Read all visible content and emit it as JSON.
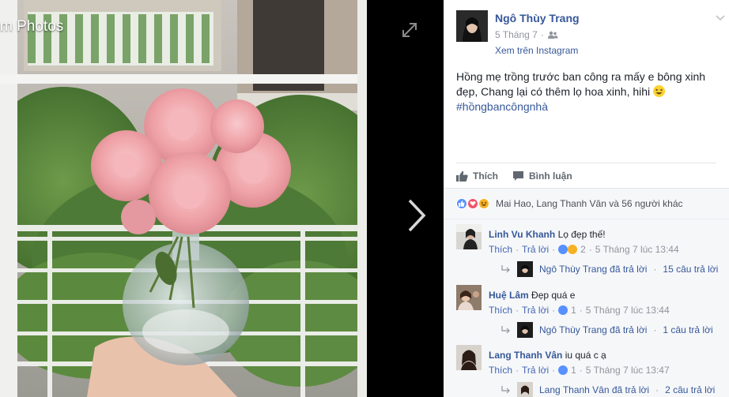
{
  "album": {
    "title": "m Photos"
  },
  "controls": {
    "expand_icon": "expand-icon",
    "next_icon": "chevron-right-icon"
  },
  "post": {
    "author": "Ngô Thùy Trang",
    "date": "5 Tháng 7",
    "date_sep": "·",
    "audience_icon": "friends-icon",
    "via": "Xem trên Instagram",
    "text": "Hồng mẹ trồng trước ban công ra mấy e bông xinh đẹp, Chang lại có thêm lọ hoa xinh, hihi",
    "hashtag": "#hồngbancôngnhà"
  },
  "actions": {
    "like": "Thích",
    "comment": "Bình luận"
  },
  "reactions": {
    "summary": "Mai Hao, Lang Thanh Vân và 56 người khác",
    "colors": {
      "like": "#5890ff",
      "love": "#f25268",
      "haha": "#f7b125"
    }
  },
  "comments": [
    {
      "name": "Linh Vu Khanh",
      "text": "Lọ đẹp thế!",
      "like": "Thích",
      "reply": "Trả lời",
      "reaction_count": "2",
      "time": "5 Tháng 7 lúc 13:44",
      "reply_by": "Ngô Thùy Trang đã trả lời",
      "reply_count": "15 câu trả lời"
    },
    {
      "name": "Huệ Lâm",
      "text": "Đẹp quá e",
      "like": "Thích",
      "reply": "Trả lời",
      "reaction_count": "1",
      "time": "5 Tháng 7 lúc 13:44",
      "reply_by": "Ngô Thùy Trang đã trả lời",
      "reply_count": "1 câu trả lời"
    },
    {
      "name": "Lang Thanh Vân",
      "text": "iu quá c ạ",
      "like": "Thích",
      "reply": "Trả lời",
      "reaction_count": "1",
      "time": "5 Tháng 7 lúc 13:47",
      "reply_by": "Lang Thanh Vân đã trả lời",
      "reply_count": "2 câu trả lời"
    }
  ],
  "colors": {
    "link": "#365899",
    "meta": "#90949c",
    "accent": "#4267b2"
  }
}
